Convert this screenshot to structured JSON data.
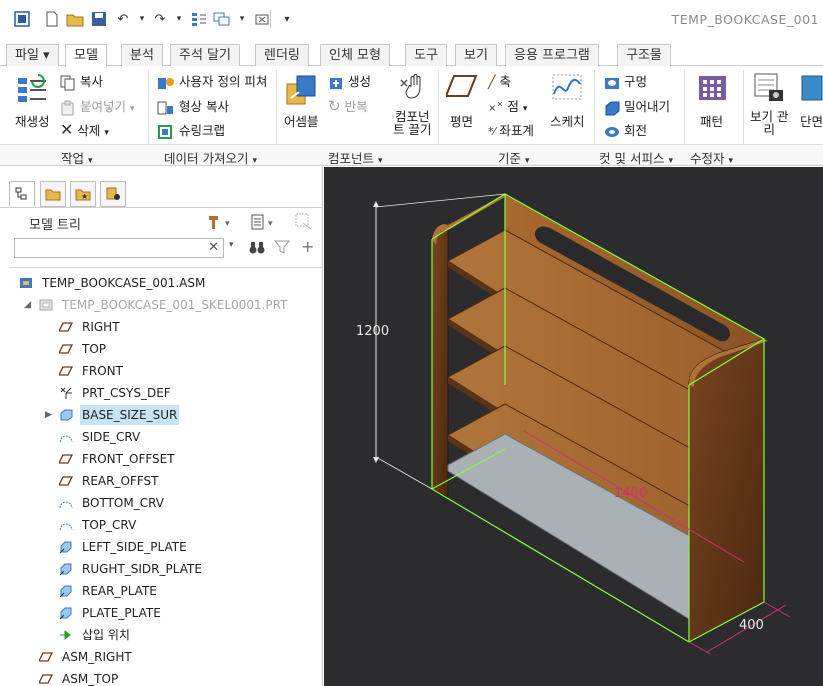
{
  "window": {
    "title": "TEMP_BOOKCASE_001"
  },
  "tabs": [
    {
      "label": "파일 ▾",
      "active": false
    },
    {
      "label": "모델",
      "active": true
    },
    {
      "label": "분석",
      "active": false
    },
    {
      "label": "주석 달기",
      "active": false
    },
    {
      "label": "렌더링",
      "active": false
    },
    {
      "label": "인체 모형",
      "active": false
    },
    {
      "label": "도구",
      "active": false
    },
    {
      "label": "보기",
      "active": false
    },
    {
      "label": "응용 프로그램",
      "active": false
    },
    {
      "label": "구조물",
      "active": false
    }
  ],
  "ribbon": {
    "operations": {
      "regenerate": "재생성",
      "copy": "복사",
      "paste": "붙여넣기",
      "delete": "삭제",
      "group": "작업"
    },
    "get_data": {
      "udf": "사용자 정의 피쳐",
      "copy_geom": "형상 복사",
      "shrinkwrap": "슈링크랩",
      "group": "데이터 가져오기"
    },
    "component": {
      "assemble": "어셈블",
      "create": "생성",
      "repeat": "반복",
      "drag_line1": "컴포넌",
      "drag_line2": "트 끌기",
      "group": "컴포넌트"
    },
    "datum": {
      "plane": "평면",
      "axis": "축",
      "point": "점",
      "csys": "좌표계",
      "sketch": "스케치",
      "group": "기준"
    },
    "cut_surface": {
      "hole": "구멍",
      "extrude": "밀어내기",
      "revolve": "회전",
      "group": "컷 및 서피스"
    },
    "modifiers": {
      "pattern": "패턴",
      "group": "수정자"
    },
    "view_manager": {
      "line1": "보기 관",
      "line2": "리"
    },
    "section": {
      "label": "단면"
    }
  },
  "model_tree": {
    "title": "모델 트리",
    "search_value": "",
    "items": [
      {
        "label": "TEMP_BOOKCASE_001.ASM",
        "icon": "assembly-icon"
      },
      {
        "label": "TEMP_BOOKCASE_001_SKEL0001.PRT",
        "icon": "skeleton-part-icon"
      },
      {
        "label": "RIGHT",
        "icon": "datum-plane-icon"
      },
      {
        "label": "TOP",
        "icon": "datum-plane-icon"
      },
      {
        "label": "FRONT",
        "icon": "datum-plane-icon"
      },
      {
        "label": "PRT_CSYS_DEF",
        "icon": "csys-icon"
      },
      {
        "label": "BASE_SIZE_SUR",
        "icon": "surface-icon"
      },
      {
        "label": "SIDE_CRV",
        "icon": "curve-icon"
      },
      {
        "label": "FRONT_OFFSET",
        "icon": "datum-plane-icon"
      },
      {
        "label": "REAR_OFFST",
        "icon": "datum-plane-icon"
      },
      {
        "label": "BOTTOM_CRV",
        "icon": "curve-icon"
      },
      {
        "label": "TOP_CRV",
        "icon": "curve-icon"
      },
      {
        "label": "LEFT_SIDE_PLATE",
        "icon": "publish-geometry-icon"
      },
      {
        "label": "RUGHT_SIDR_PLATE",
        "icon": "publish-geometry-icon"
      },
      {
        "label": "REAR_PLATE",
        "icon": "publish-geometry-icon"
      },
      {
        "label": "PLATE_PLATE",
        "icon": "publish-geometry-icon"
      },
      {
        "label": "삽입 위치",
        "icon": "insert-here-icon"
      },
      {
        "label": "ASM_RIGHT",
        "icon": "datum-plane-icon"
      },
      {
        "label": "ASM_TOP",
        "icon": "datum-plane-icon"
      }
    ]
  },
  "viewport": {
    "dimensions": {
      "height": "1200",
      "width": "1400",
      "depth": "400"
    },
    "colors": {
      "background": "#2c2c2e",
      "wood": "#9a5f2c",
      "wood_dark": "#5b3418",
      "highlight": "#7fff3a",
      "dim_white": "#e8e8e8",
      "dim_magenta": "#d0307a"
    }
  }
}
